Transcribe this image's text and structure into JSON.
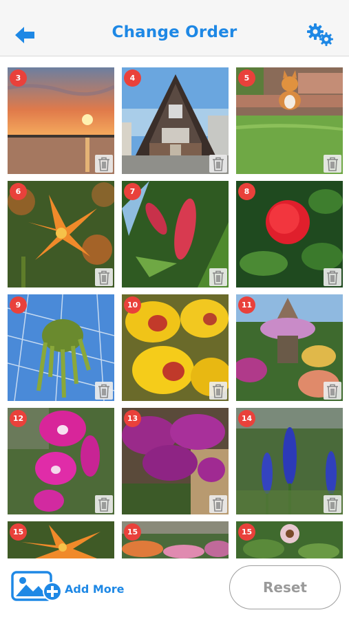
{
  "header": {
    "title": "Change Order",
    "back_icon": "arrow-left-icon",
    "settings_icon": "gear-icon",
    "accent_color": "#1e88e5"
  },
  "photos": [
    {
      "badge": "3",
      "subject": "sunset-over-water",
      "removable": true
    },
    {
      "badge": "4",
      "subject": "a-frame-house",
      "removable": true
    },
    {
      "badge": "5",
      "subject": "corgi-on-lawn",
      "removable": true
    },
    {
      "badge": "6",
      "subject": "orange-lilies",
      "removable": true
    },
    {
      "badge": "7",
      "subject": "red-flower-spikes",
      "removable": true
    },
    {
      "badge": "8",
      "subject": "red-puff-flower",
      "removable": true
    },
    {
      "badge": "9",
      "subject": "hanging-plant-greenhouse",
      "removable": true
    },
    {
      "badge": "10",
      "subject": "yellow-orchids",
      "removable": true
    },
    {
      "badge": "11",
      "subject": "garden-gazebo",
      "removable": true
    },
    {
      "badge": "12",
      "subject": "pink-orchids",
      "removable": true
    },
    {
      "badge": "13",
      "subject": "purple-orchids",
      "removable": true
    },
    {
      "badge": "14",
      "subject": "blue-delphinium",
      "removable": true
    },
    {
      "badge": "15",
      "subject": "orange-lilies",
      "removable": false
    },
    {
      "badge": "15",
      "subject": "flower-garden",
      "removable": false
    },
    {
      "badge": "15",
      "subject": "coneflower",
      "removable": false
    }
  ],
  "footer": {
    "add_more_label": "Add More",
    "add_more_icon": "add-photo-icon",
    "reset_label": "Reset"
  },
  "colors": {
    "badge": "#e9413b",
    "accent": "#1e88e5",
    "reset_text": "#9a9a9a"
  }
}
